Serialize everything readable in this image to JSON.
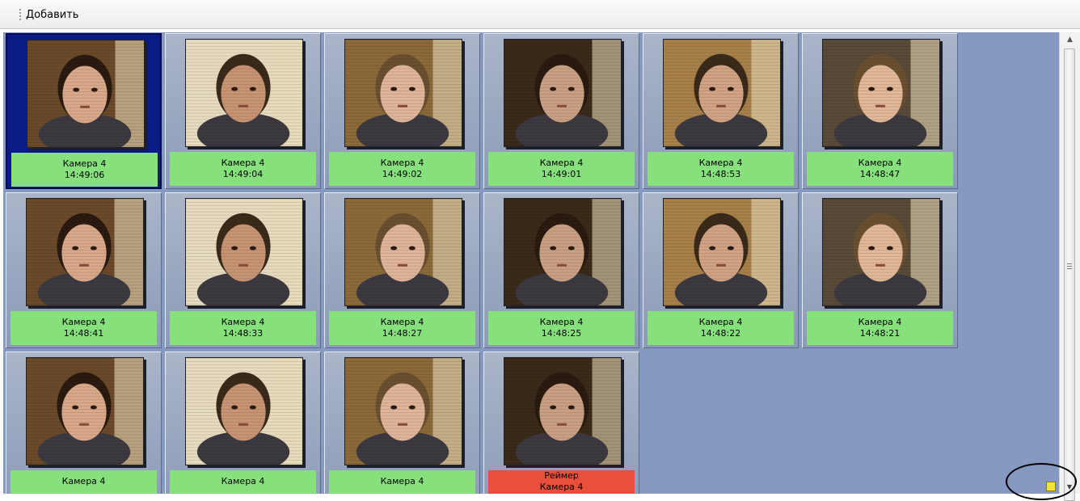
{
  "toolbar": {
    "add_label": "Добавить"
  },
  "tiles": [
    {
      "camera": "Камера 4",
      "time": "14:49:06",
      "selected": true
    },
    {
      "camera": "Камера 4",
      "time": "14:49:04"
    },
    {
      "camera": "Камера 4",
      "time": "14:49:02"
    },
    {
      "camera": "Камера 4",
      "time": "14:49:01"
    },
    {
      "camera": "Камера 4",
      "time": "14:48:53"
    },
    {
      "camera": "Камера 4",
      "time": "14:48:47"
    },
    {
      "camera": "Камера 4",
      "time": "14:48:41"
    },
    {
      "camera": "Камера 4",
      "time": "14:48:33"
    },
    {
      "camera": "Камера 4",
      "time": "14:48:27"
    },
    {
      "camera": "Камера 4",
      "time": "14:48:25"
    },
    {
      "camera": "Камера 4",
      "time": "14:48:22"
    },
    {
      "camera": "Камера 4",
      "time": "14:48:21"
    },
    {
      "camera": "Камера 4",
      "time": ""
    },
    {
      "camera": "Камера 4",
      "time": ""
    },
    {
      "camera": "Камера 4",
      "time": ""
    },
    {
      "name": "Реймер",
      "camera": "Камера 4",
      "time": "",
      "alarm": true
    }
  ],
  "colors": {
    "match_ok": "#86e07c",
    "match_alarm": "#e8503c",
    "grid_background": "#8599c1",
    "selection": "#0a1a86"
  },
  "icons": {
    "toolbar_grip": "grip-icon",
    "scroll_up": "chevron-up-icon",
    "scroll_down": "chevron-down-icon",
    "resize": "resize-grip-icon"
  }
}
